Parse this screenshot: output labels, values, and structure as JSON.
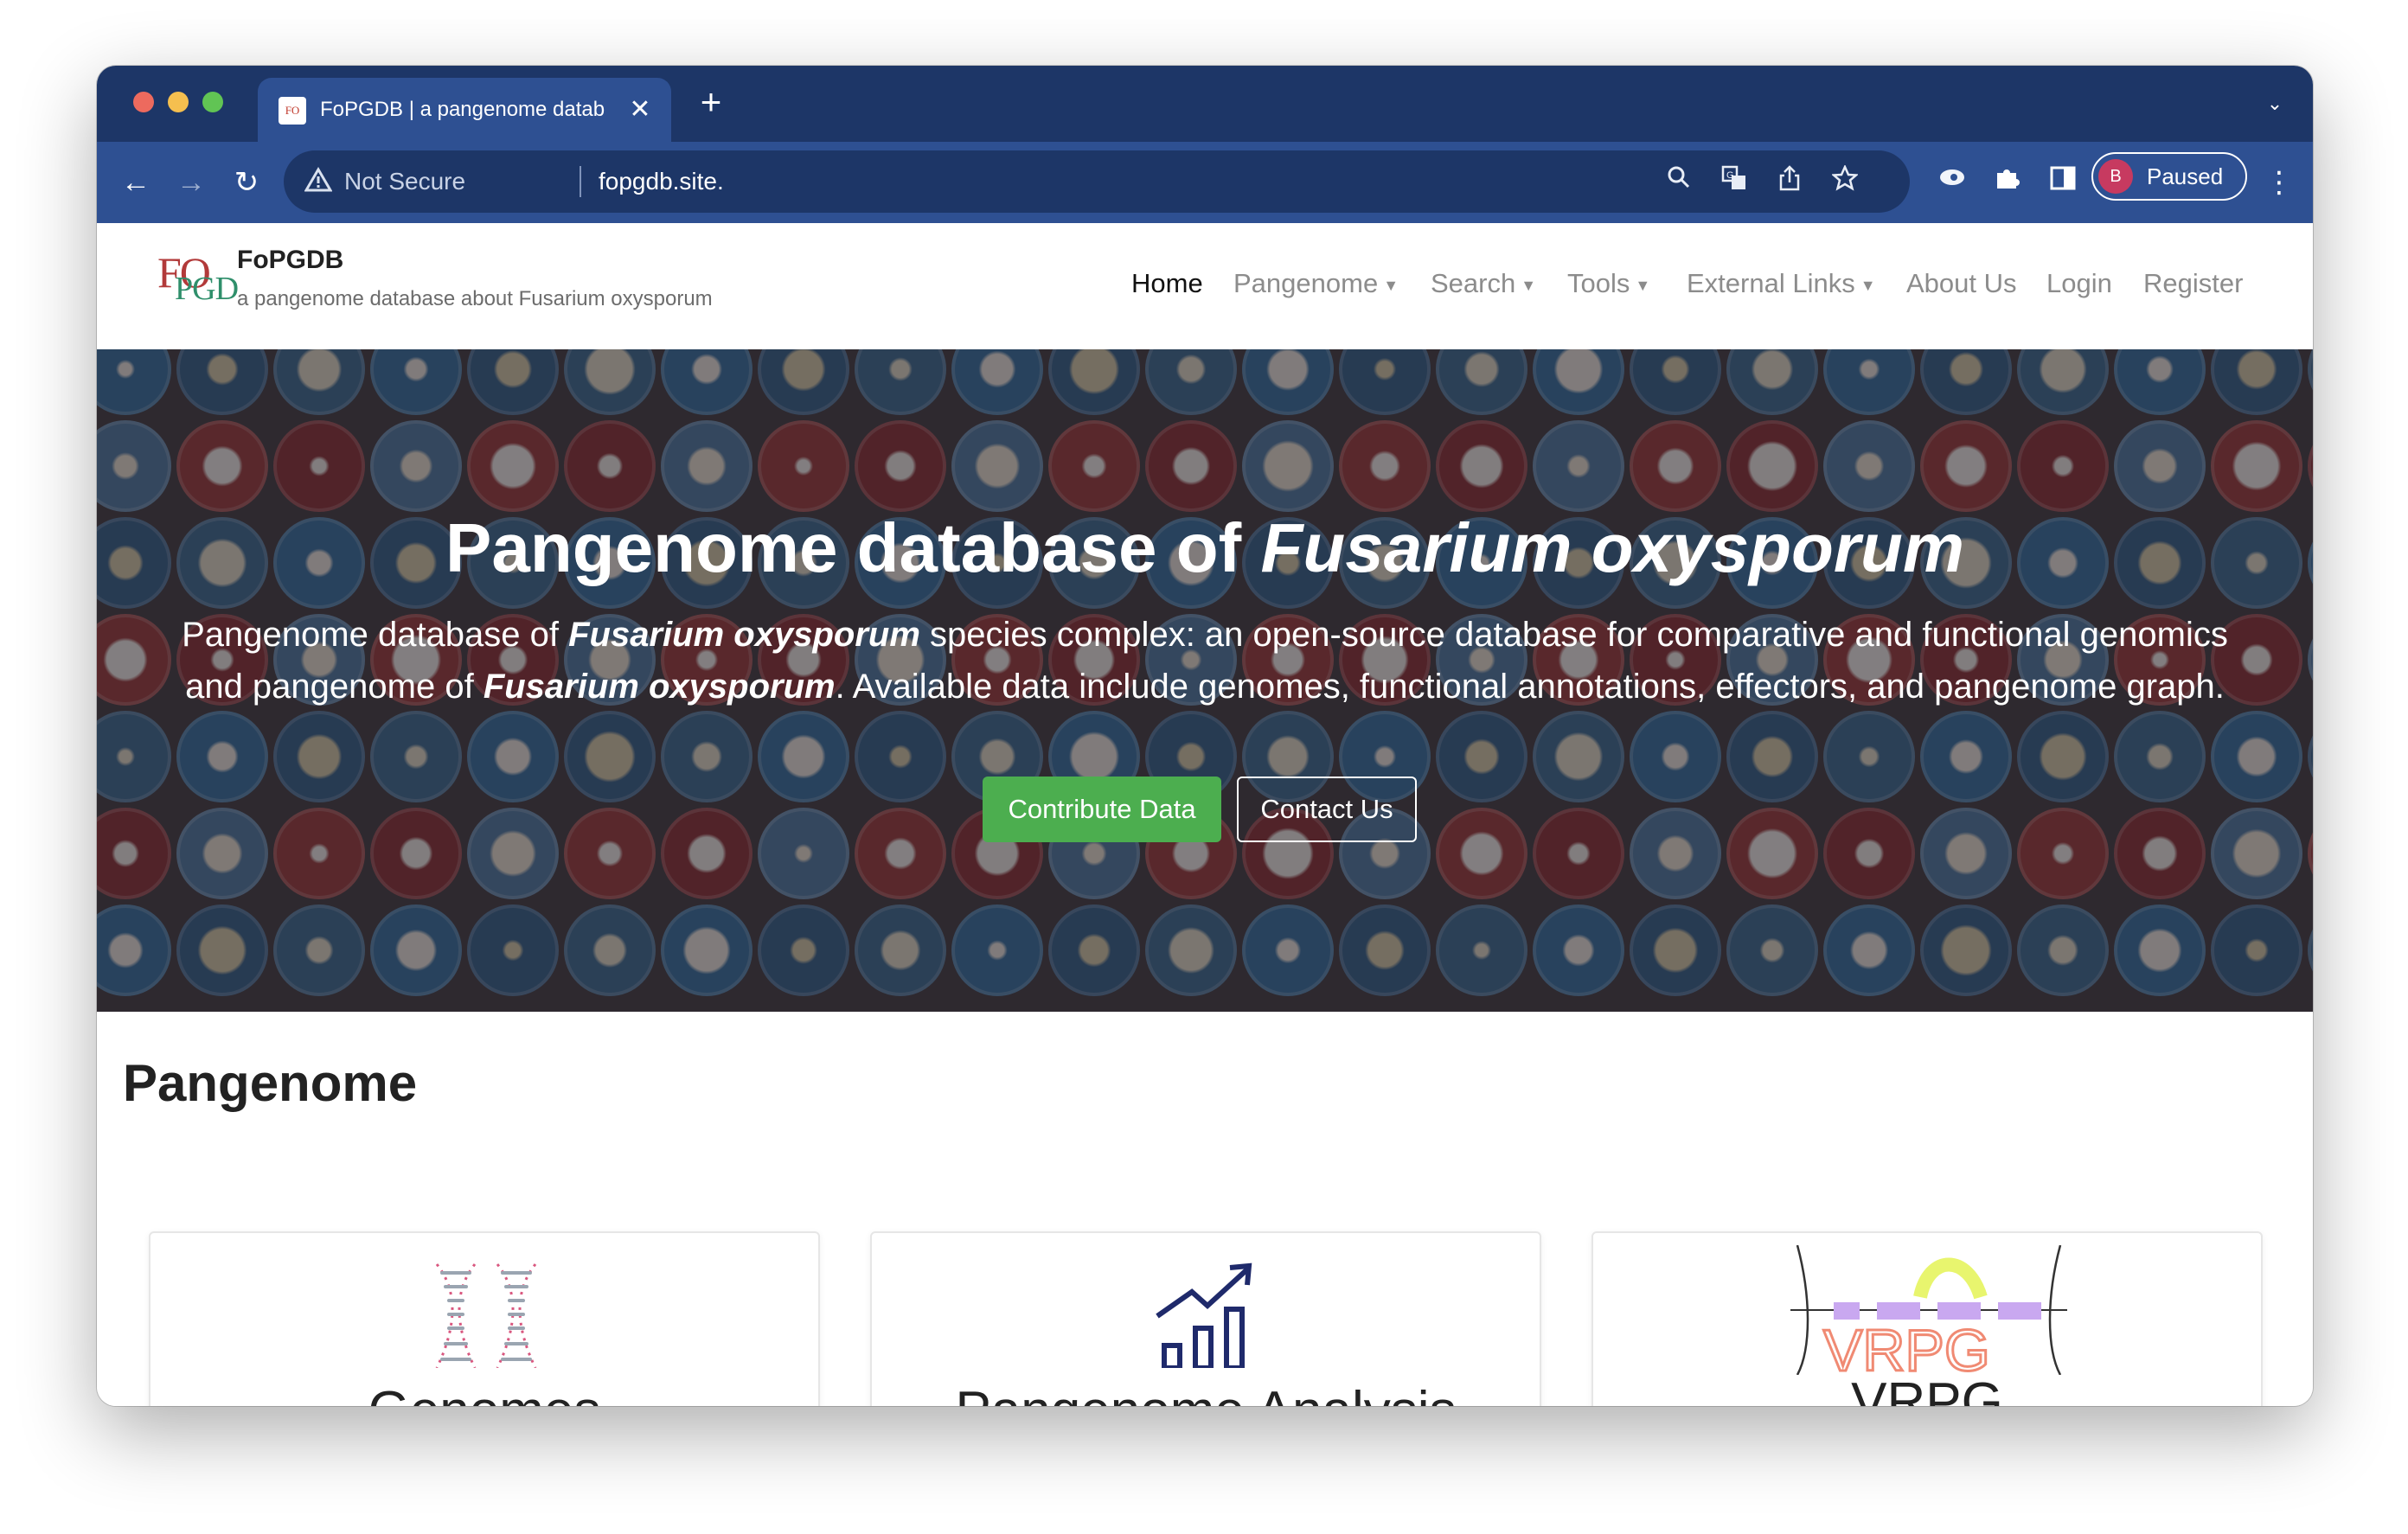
{
  "browser": {
    "tab": {
      "favicon_text": "FO",
      "title": "FoPGDB | a pangenome datab",
      "close_glyph": "✕"
    },
    "new_tab_glyph": "+",
    "tab_list_glyph": "⌄",
    "toolbar": {
      "back_glyph": "←",
      "forward_glyph": "→",
      "reload_glyph": "↻",
      "security_text": "Not Secure",
      "url": "fopgdb.site.",
      "profile": {
        "initial": "B",
        "label": "Paused"
      },
      "menu_glyph": "⋮"
    },
    "icons": {
      "warning": "warning-icon",
      "zoom": "magnifier-icon",
      "translate": "translate-icon",
      "share": "share-icon",
      "bookmark": "star-icon",
      "extension_a": "eye-extension-icon",
      "extensions": "puzzle-icon",
      "sidepanel": "sidepanel-icon"
    }
  },
  "site": {
    "brand": {
      "logo_fo": "FO",
      "logo_pgd": "PGD",
      "title": "FoPGDB",
      "subtitle": "a pangenome database about Fusarium oxysporum"
    },
    "nav": [
      {
        "label": "Home",
        "active": true,
        "dropdown": false
      },
      {
        "label": "Pangenome",
        "active": false,
        "dropdown": true
      },
      {
        "label": "Search",
        "active": false,
        "dropdown": true
      },
      {
        "label": "Tools",
        "active": false,
        "dropdown": true
      },
      {
        "label": "External Links",
        "active": false,
        "dropdown": true
      },
      {
        "label": "About Us",
        "active": false,
        "dropdown": false
      },
      {
        "label": "Login",
        "active": false,
        "dropdown": false
      },
      {
        "label": "Register",
        "active": false,
        "dropdown": false
      }
    ],
    "hero": {
      "title_plain": "Pangenome database of ",
      "title_italic": "Fusarium oxysporum",
      "text_1": "Pangenome database of ",
      "text_italic_1": "Fusarium oxysporum",
      "text_2": " species complex: an open-source database for comparative and functional genomics and pangenome of ",
      "text_italic_2": "Fusarium oxysporum",
      "text_3": ". Available data include genomes, functional annotations, effectors, and pangenome graph.",
      "button_contribute": "Contribute Data",
      "button_contact": "Contact Us"
    },
    "section": {
      "title": "Pangenome",
      "cards": [
        {
          "title": "Genomes",
          "icon": "dna-strands-icon"
        },
        {
          "title": "Pangenome Analysis",
          "icon": "growth-chart-icon"
        },
        {
          "title": "VRPG",
          "icon": "vrpg-logo-icon",
          "logo_text": "VRPG"
        }
      ]
    },
    "colors": {
      "browser_frame": "#1d3667",
      "browser_toolbar": "#2e5092",
      "contribute_green": "#4cae4f",
      "chart_navy": "#1f2a6b",
      "vrpg_salmon": "#f08a73",
      "vrpg_purple": "#c9a8f0",
      "dna_pink": "#d9577f",
      "dna_gray": "#9aa5b1"
    }
  }
}
